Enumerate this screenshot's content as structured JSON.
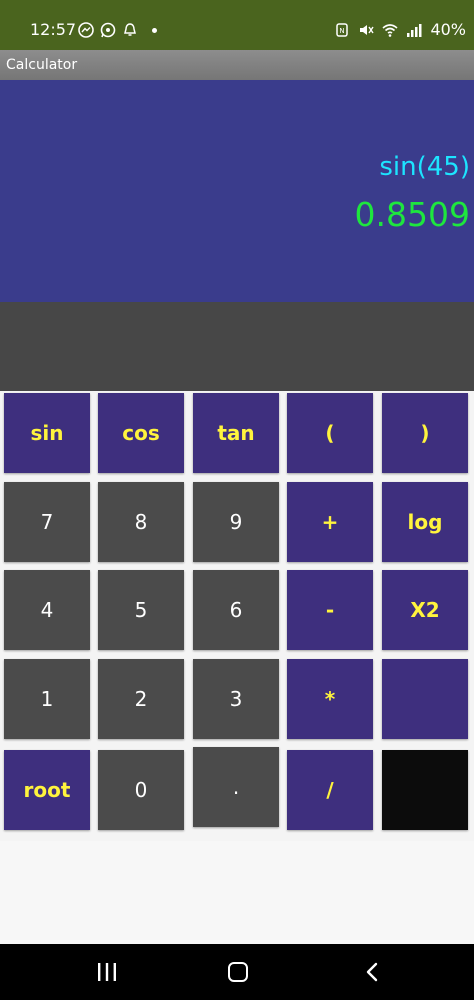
{
  "status_bar": {
    "time": "12:57",
    "battery": "40%",
    "left_icons": [
      "messenger-icon",
      "whatsapp-icon",
      "notification-icon"
    ],
    "right_icons": [
      "nfc-icon",
      "mute-icon",
      "wifi-icon",
      "signal-icon"
    ]
  },
  "app": {
    "title": "Calculator"
  },
  "display": {
    "expression": "sin(45)",
    "result": "0.8509",
    "colors": {
      "background": "#3a3c8c",
      "expression": "#1de4ff",
      "result": "#1ee63e"
    }
  },
  "keypad": {
    "rows": [
      [
        "sin",
        "cos",
        "tan",
        "(",
        ")"
      ],
      [
        "7",
        "8",
        "9",
        "+",
        "log"
      ],
      [
        "4",
        "5",
        "6",
        "-",
        "X2"
      ],
      [
        "1",
        "2",
        "3",
        "*",
        ""
      ],
      [
        "root",
        "0",
        ".",
        "/",
        ""
      ]
    ],
    "colors": {
      "operator_bg": "#3e2f7e",
      "operator_text": "#fff43d",
      "number_bg": "#4b4b4b",
      "number_text": "#ffffff"
    }
  },
  "nav_bar": {
    "icons": [
      "recent-apps-icon",
      "home-icon",
      "back-icon"
    ]
  }
}
